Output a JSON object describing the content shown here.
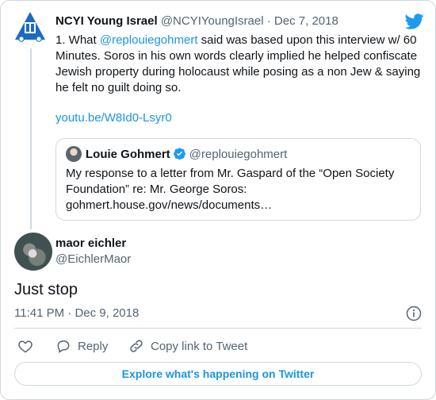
{
  "colors": {
    "link": "#1b95e0",
    "secondary_text": "#536471",
    "border": "#cfd9de",
    "twitter_blue": "#1d9bf0"
  },
  "parent_tweet": {
    "author_name": "NCYI Young Israel",
    "author_handle": "@NCYIYoungIsrael",
    "separator": "·",
    "date": "Dec 7, 2018",
    "text_prefix": "1. What ",
    "mention": "@replouiegohmert",
    "text_rest": " said was based upon this interview w/ 60 Minutes. Soros in his own words clearly implied he helped confiscate Jewish property during holocaust while posing as a non Jew & saying he felt no guilt doing so.",
    "link": "youtu.be/W8Id0-Lsyr0",
    "avatar_icon": "ncyi-logo-icon"
  },
  "quoted_tweet": {
    "author_name": "Louie Gohmert",
    "verified_icon": "verified-badge-icon",
    "author_handle": "@replouiegohmert",
    "text": "My response to a letter from Mr. Gaspard of the “Open Society Foundation” re: Mr. George Soros: gohmert.house.gov/news/documents…"
  },
  "main_tweet": {
    "author_name": "maor eichler",
    "author_handle": "@EichlerMaor",
    "text": "Just stop",
    "time": "11:41 PM",
    "separator": "·",
    "date": "Dec 9, 2018"
  },
  "actions": {
    "like_icon": "heart-icon",
    "reply_label": "Reply",
    "copy_label": "Copy link to Tweet"
  },
  "explore_label": "Explore what's happening on Twitter"
}
